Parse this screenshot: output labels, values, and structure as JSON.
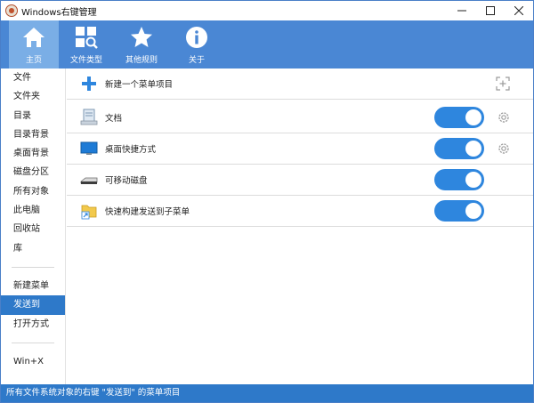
{
  "window": {
    "title": "Windows右键管理"
  },
  "toolbar": {
    "items": [
      {
        "label": "主页"
      },
      {
        "label": "文件类型"
      },
      {
        "label": "其他规则"
      },
      {
        "label": "关于"
      }
    ]
  },
  "sidebar": {
    "items": [
      {
        "label": "文件"
      },
      {
        "label": "文件夹"
      },
      {
        "label": "目录"
      },
      {
        "label": "目录背景"
      },
      {
        "label": "桌面背景"
      },
      {
        "label": "磁盘分区"
      },
      {
        "label": "所有对象"
      },
      {
        "label": "此电脑"
      },
      {
        "label": "回收站"
      },
      {
        "label": "库"
      },
      {
        "label": "新建菜单"
      },
      {
        "label": "发送到"
      },
      {
        "label": "打开方式"
      },
      {
        "label": "Win+X"
      }
    ],
    "selected": "发送到"
  },
  "content": {
    "new_item_label": "新建一个菜单项目",
    "rows": [
      {
        "label": "文档",
        "enabled": true
      },
      {
        "label": "桌面快捷方式",
        "enabled": true
      },
      {
        "label": "可移动磁盘",
        "enabled": true
      },
      {
        "label": "快速构建发送到子菜单",
        "enabled": true
      }
    ]
  },
  "status": {
    "text": "所有文件系统对象的右键 \"发送到\" 的菜单项目"
  },
  "colors": {
    "toolbar_bg": "#4a87d4",
    "toolbar_active": "#7aaee6",
    "accent": "#2e79c9",
    "toggle_on": "#2e86de"
  }
}
